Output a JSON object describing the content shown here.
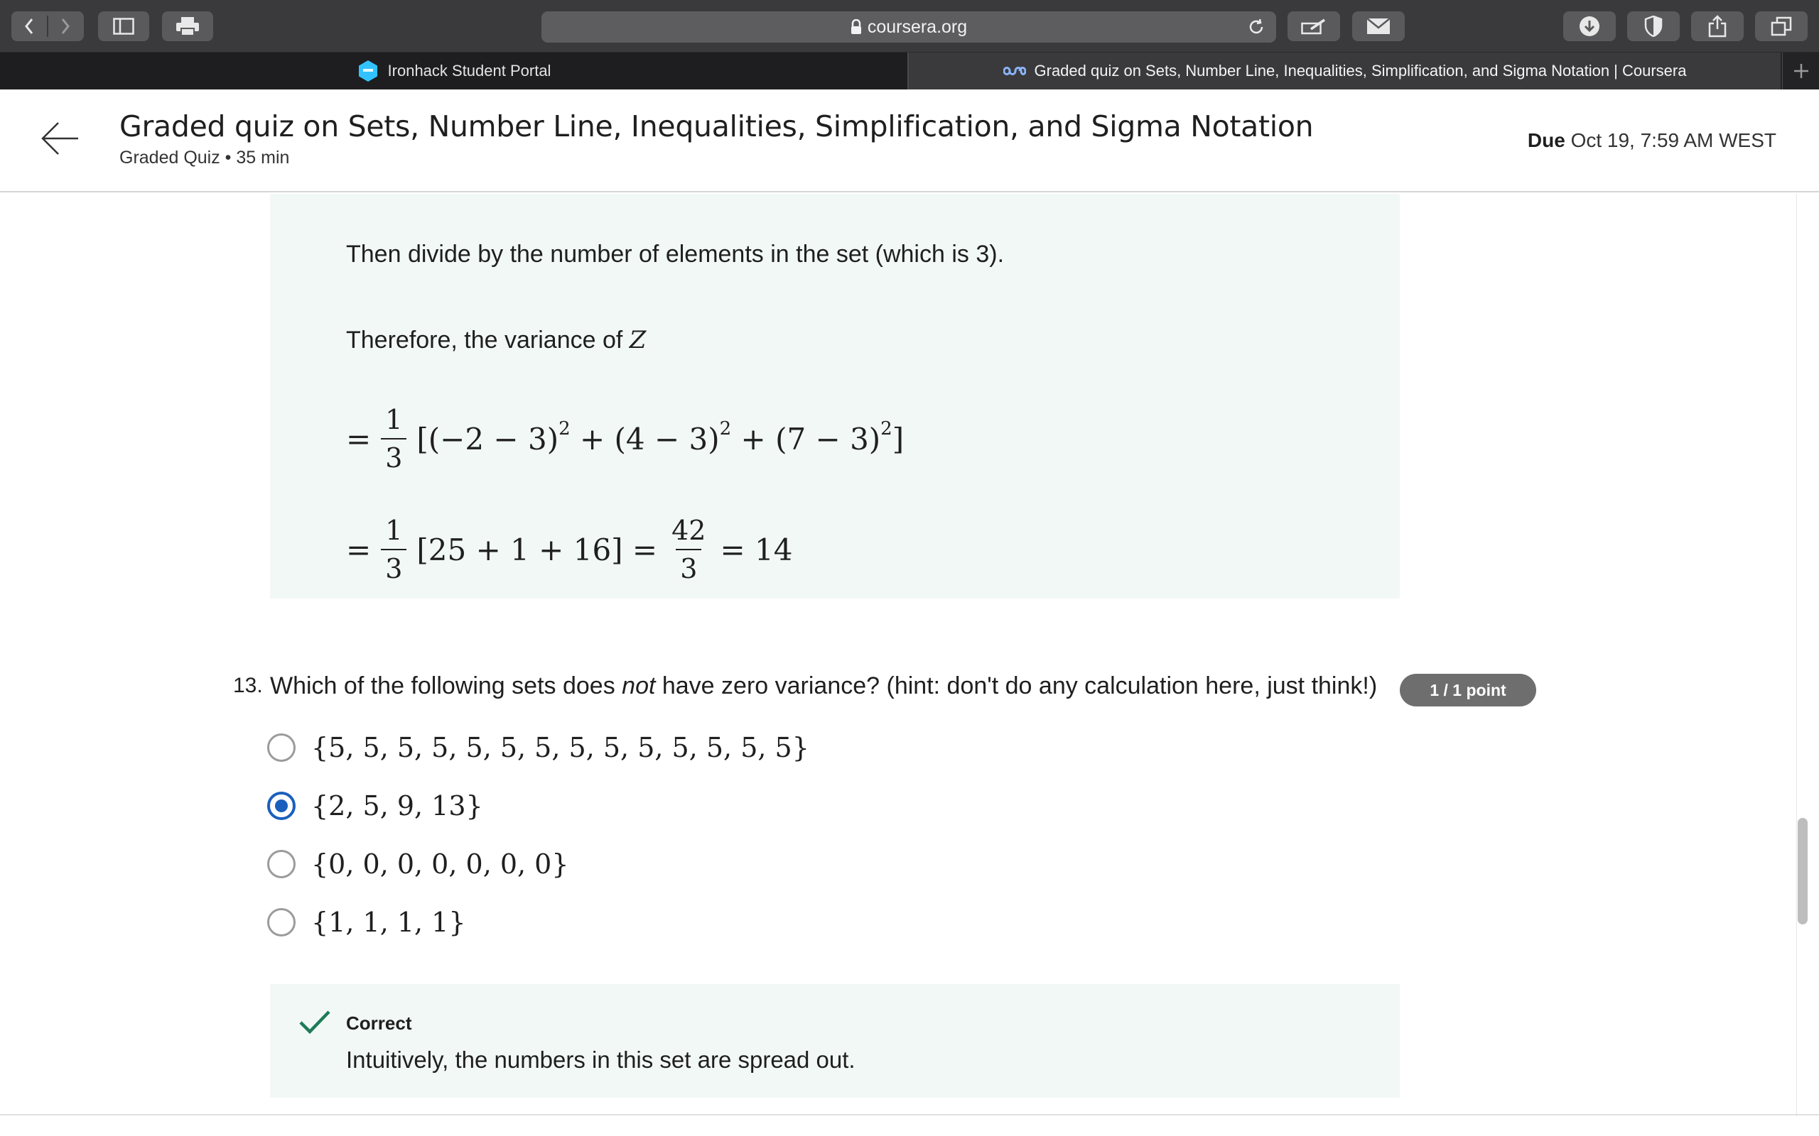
{
  "browser": {
    "url": "coursera.org",
    "tabs": [
      {
        "label": "Ironhack Student Portal"
      },
      {
        "label": "Graded quiz on Sets, Number Line, Inequalities, Simplification, and Sigma Notation | Coursera"
      }
    ]
  },
  "header": {
    "title": "Graded quiz on Sets, Number Line, Inequalities, Simplification, and Sigma Notation",
    "subtitle": "Graded Quiz • 35 min",
    "due_label": "Due",
    "due_value": "Oct 19, 7:59 AM WEST"
  },
  "explanation": {
    "line1": "Then divide by the number of elements in the set (which is 3).",
    "line2_prefix": "Therefore, the variance of ",
    "line2_var": "Z",
    "eq1": {
      "lead": "=",
      "num": "1",
      "den": "3",
      "body_1": "[(−2 − 3)",
      "exp_1": "2",
      "body_2": " + (4 − 3)",
      "exp_2": "2",
      "body_3": " + (7 − 3)",
      "exp_3": "2",
      "body_4": "]"
    },
    "eq2": {
      "lead": "=",
      "num": "1",
      "den": "3",
      "body": "[25 + 1 + 16] =",
      "num2": "42",
      "den2": "3",
      "tail": "= 14"
    }
  },
  "question": {
    "number": "13.",
    "text_before": "Which of the following sets does ",
    "text_em": "not",
    "text_after": " have zero variance? (hint: don't do any calculation here, just think!)",
    "points": "1 / 1 point",
    "options": [
      {
        "label": "{5, 5, 5, 5, 5, 5, 5, 5, 5, 5, 5, 5, 5, 5}",
        "selected": false
      },
      {
        "label": "{2, 5, 9, 13}",
        "selected": true
      },
      {
        "label": "{0, 0, 0, 0, 0, 0, 0}",
        "selected": false
      },
      {
        "label": "{1, 1, 1, 1}",
        "selected": false
      }
    ]
  },
  "feedback": {
    "status": "Correct",
    "text": "Intuitively, the numbers in this set are spread out."
  },
  "colors": {
    "accent": "#1b5fbd",
    "correct_green": "#1e7b58",
    "panel_bg": "#f2f8f6",
    "points_badge": "#6e6e6e"
  }
}
